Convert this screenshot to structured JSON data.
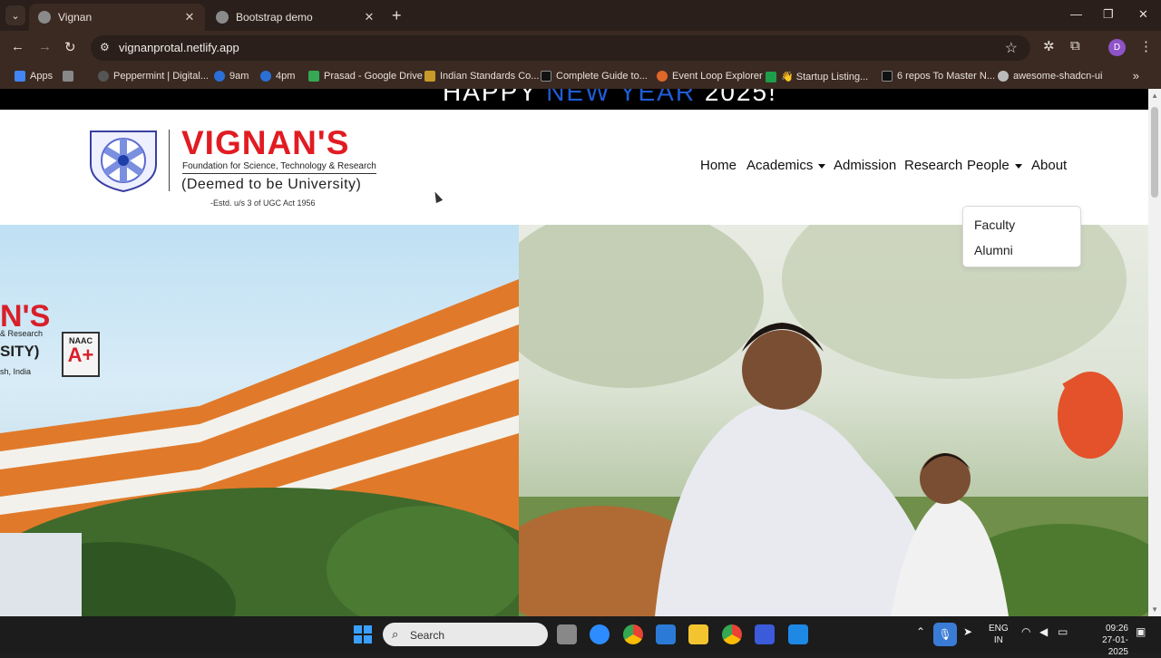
{
  "browser": {
    "tabs": [
      {
        "title": "Vignan",
        "active": true
      },
      {
        "title": "Bootstrap demo",
        "active": false
      }
    ],
    "url": "vignanprotal.netlify.app",
    "profile_initial": "D",
    "bookmarks": [
      {
        "label": "Apps",
        "color": "#4285f4"
      },
      {
        "label": "",
        "color": "#bbbbbb"
      },
      {
        "label": "Peppermint | Digital...",
        "color": "#333333"
      },
      {
        "label": "9am",
        "color": "#2b6fd6"
      },
      {
        "label": "4pm",
        "color": "#2b6fd6"
      },
      {
        "label": "Prasad - Google Drive",
        "color": "#34a853"
      },
      {
        "label": "Indian Standards Co...",
        "color": "#c79a2a"
      },
      {
        "label": "Complete Guide to...",
        "color": "#111111"
      },
      {
        "label": "Event Loop Explorer",
        "color": "#e0672a"
      },
      {
        "label": "👋 Startup Listing...",
        "color": "#1e9e4a"
      },
      {
        "label": "6 repos To Master N...",
        "color": "#111111"
      },
      {
        "label": "awesome-shadcn-ui",
        "color": "#bbbbbb"
      }
    ]
  },
  "page": {
    "banner_parts": [
      "HAPPY ",
      "NEW YEAR",
      " 2025!"
    ],
    "logo": {
      "name": "VIGNAN'S",
      "subtitle": "Foundation for Science, Technology & Research",
      "deemed": "(Deemed to be University)",
      "estd": "-Estd. u/s 3 of UGC Act 1956"
    },
    "nav": [
      "Home",
      "Academics",
      "Admission",
      "Research",
      "People",
      "About"
    ],
    "dropdown": [
      "Faculty",
      "Alumni"
    ],
    "hero_sign": {
      "name": "N'S",
      "line1": "& Research",
      "line2": "SITY)",
      "line3": "sh, India",
      "naac": "NAAC",
      "grade": "A+"
    }
  },
  "taskbar": {
    "search_placeholder": "Search",
    "lang_line1": "ENG",
    "lang_line2": "IN",
    "time": "09:26",
    "date": "27-01-2025"
  }
}
